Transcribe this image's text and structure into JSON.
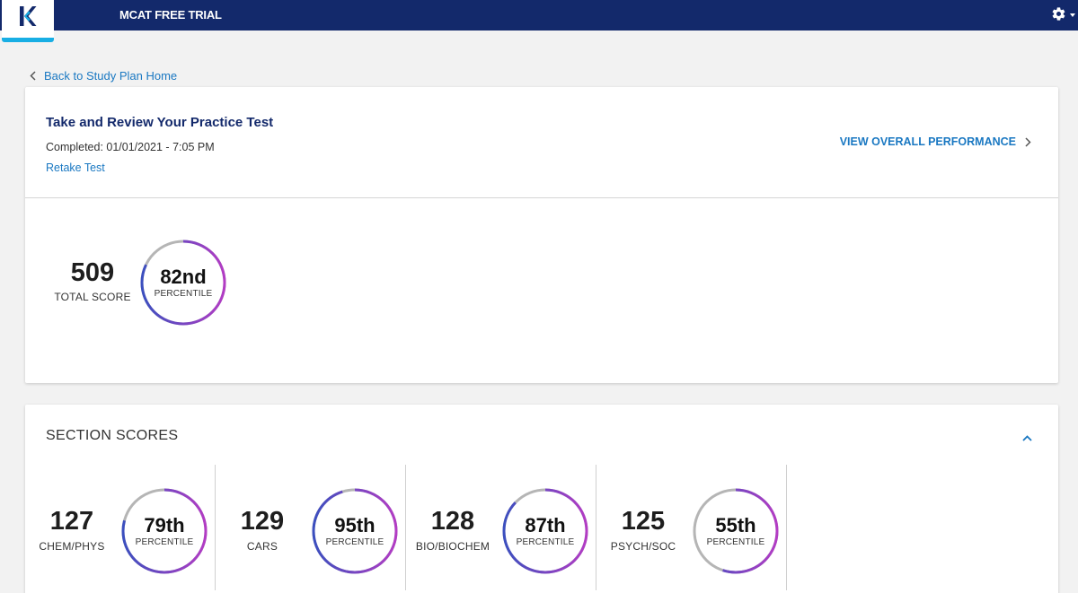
{
  "header": {
    "logo_letter": "K",
    "app_title": "MCAT FREE TRIAL",
    "settings_icon": "gear-icon",
    "colors": {
      "navbar": "#13296b",
      "logo_accent": "#18aee4",
      "link": "#1a78c2"
    }
  },
  "back_link": {
    "label": "Back to Study Plan Home",
    "icon": "chevron-left-icon"
  },
  "test_card": {
    "title": "Take and Review Your Practice Test",
    "completed": "Completed: 01/01/2021 - 7:05 PM",
    "retake_label": "Retake Test",
    "overall_label": "VIEW OVERALL PERFORMANCE",
    "overall_icon": "chevron-right-icon",
    "total": {
      "score": "509",
      "label": "TOTAL SCORE",
      "percentile_main": "82nd",
      "percentile_sub": "PERCENTILE",
      "percentile_value": 82
    }
  },
  "sections_card": {
    "heading": "SECTION SCORES",
    "collapse_icon": "chevron-up-icon",
    "sections": [
      {
        "score": "127",
        "name": "CHEM/PHYS",
        "percentile_main": "79th",
        "percentile_sub": "PERCENTILE",
        "percentile_value": 79
      },
      {
        "score": "129",
        "name": "CARS",
        "percentile_main": "95th",
        "percentile_sub": "PERCENTILE",
        "percentile_value": 95
      },
      {
        "score": "128",
        "name": "BIO/BIOCHEM",
        "percentile_main": "87th",
        "percentile_sub": "PERCENTILE",
        "percentile_value": 87
      },
      {
        "score": "125",
        "name": "PSYCH/SOC",
        "percentile_main": "55th",
        "percentile_sub": "PERCENTILE",
        "percentile_value": 55
      }
    ]
  }
}
